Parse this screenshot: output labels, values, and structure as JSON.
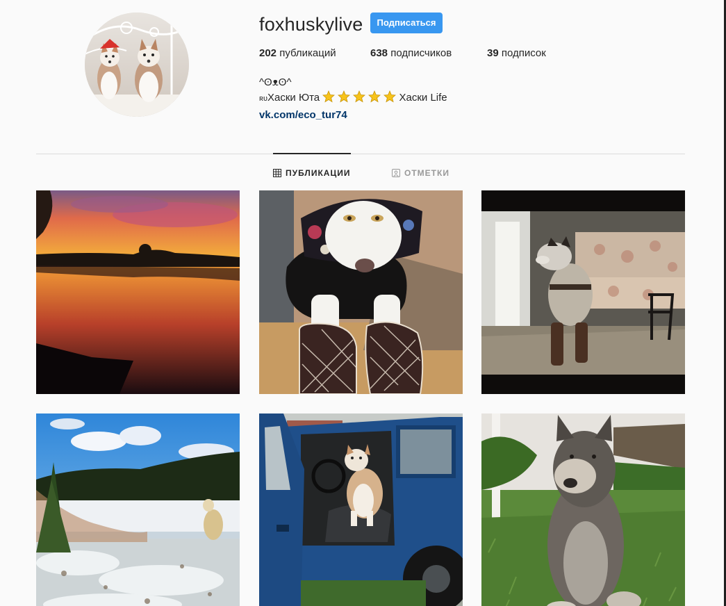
{
  "profile": {
    "username": "foxhuskylive",
    "follow_label": "Подписаться",
    "avatar_alt": "profile-photo-two-husky-puppies"
  },
  "stats": {
    "posts_count": "202",
    "posts_label": "публикаций",
    "followers_count": "638",
    "followers_label": "подписчиков",
    "following_count": "39",
    "following_label": "подписок"
  },
  "bio": {
    "line1": "^ʘᴥʘ^",
    "line2_prefix": "ʀᴜ",
    "line2_text": "Хаски Юта",
    "line2_suffix": "Хаски Life",
    "stars_count": 5,
    "link": "vk.com/eco_tur74"
  },
  "tabs": [
    {
      "label": "ПУБЛИКАЦИИ",
      "active": true,
      "icon": "grid-icon"
    },
    {
      "label": "ОТМЕТКИ",
      "active": false,
      "icon": "tagged-person-icon"
    }
  ],
  "colors": {
    "accent": "#3897f0",
    "link": "#003569",
    "text": "#262626",
    "muted": "#999999",
    "background": "#fafafa"
  },
  "posts": [
    {
      "subject": "sunset-over-lake"
    },
    {
      "subject": "husky-in-headscarf-and-slippers"
    },
    {
      "subject": "husky-in-boots-by-sofa"
    },
    {
      "subject": "husky-on-snowy-lakeshore"
    },
    {
      "subject": "husky-in-blue-car"
    },
    {
      "subject": "old-husky-on-grass"
    }
  ]
}
